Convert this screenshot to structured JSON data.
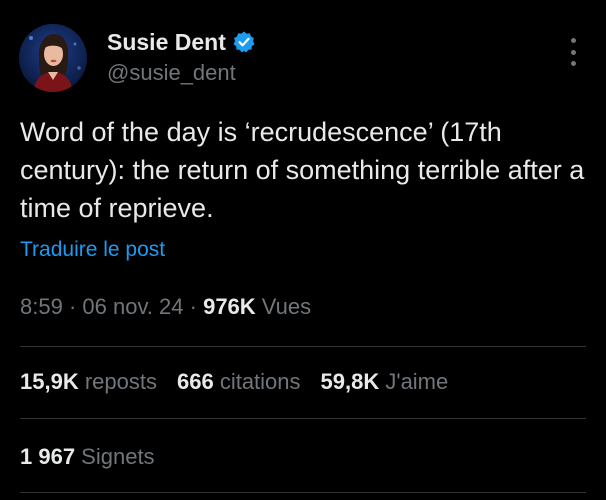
{
  "author": {
    "display_name": "Susie Dent",
    "handle": "@susie_dent",
    "verified": true,
    "avatar_icon": "avatar-portrait"
  },
  "post": {
    "text": "Word of the day is ‘recrudescence’ (17th century): the return of something terrible after a time of reprieve.",
    "translate_label": "Traduire le post"
  },
  "meta": {
    "time": "8:59",
    "separator1": " · ",
    "date": "06 nov. 24",
    "separator2": " · ",
    "views_count": "976K",
    "views_label": " Vues"
  },
  "stats": {
    "reposts_count": "15,9K",
    "reposts_label": " reposts",
    "quotes_count": "666",
    "quotes_label": " citations",
    "likes_count": "59,8K",
    "likes_label": " J'aime",
    "bookmarks_count": "1 967",
    "bookmarks_label": " Signets"
  },
  "colors": {
    "background": "#000000",
    "text_primary": "#e7e9ea",
    "text_secondary": "#71767b",
    "link": "#1d9bf0",
    "verified_badge": "#1d9bf0",
    "divider": "#2f3336"
  }
}
